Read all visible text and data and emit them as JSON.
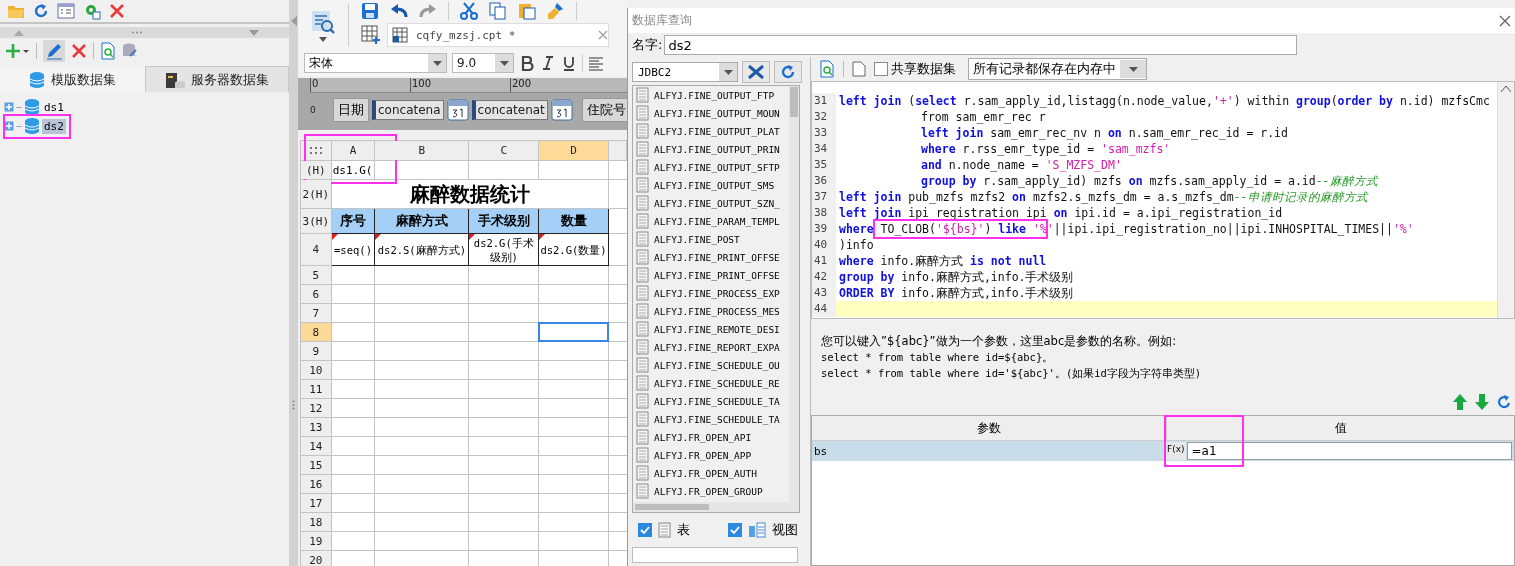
{
  "dataset_tabs": [
    {
      "label": "模版数据集",
      "selected": true
    },
    {
      "label": "服务器数据集",
      "selected": false
    }
  ],
  "datasets": [
    {
      "name": "ds1",
      "selected": false,
      "highlighted": false
    },
    {
      "name": "ds2",
      "selected": true,
      "highlighted": true
    }
  ],
  "designer": {
    "file_tab": "cqfy_mzsj.cpt *",
    "font": "宋体",
    "font_size": "9.0",
    "ruler_ticks": [
      "0",
      "100",
      "200"
    ],
    "ruler_side": "0",
    "params": [
      {
        "kind": "label",
        "text": "日期"
      },
      {
        "kind": "date",
        "text": "concatena"
      },
      {
        "kind": "date",
        "text": "concatenat"
      },
      {
        "kind": "label",
        "text": "住院号"
      }
    ],
    "sheet": {
      "corner_highlighted": true,
      "columns": [
        {
          "label": "A",
          "selected": false
        },
        {
          "label": "B",
          "selected": false
        },
        {
          "label": "C",
          "selected": false
        },
        {
          "label": "D",
          "selected": true
        }
      ],
      "rows": [
        {
          "header": "(H)",
          "kind": "plain",
          "selected": false,
          "cells": [
            "ds1.G("
          ]
        },
        {
          "header": "2(H)",
          "kind": "title",
          "selected": false,
          "cells": [
            "麻醉数据统计"
          ]
        },
        {
          "header": "3(H)",
          "kind": "heading",
          "selected": false,
          "cells": [
            "序号",
            "麻醉方式",
            "手术级别",
            "数量"
          ]
        },
        {
          "header": "4",
          "kind": "formula",
          "selected": false,
          "cells": [
            "=seq()",
            "ds2.S(麻醉方式)",
            "ds2.G(手术级别)",
            "ds2.G(数量)"
          ]
        },
        {
          "header": "5",
          "kind": "plain",
          "selected": false
        },
        {
          "header": "6",
          "kind": "plain",
          "selected": false
        },
        {
          "header": "7",
          "kind": "plain",
          "selected": false
        },
        {
          "header": "8",
          "kind": "plain",
          "selected": true
        },
        {
          "header": "9",
          "kind": "plain",
          "selected": false
        },
        {
          "header": "10",
          "kind": "plain",
          "selected": false
        },
        {
          "header": "11",
          "kind": "plain",
          "selected": false
        },
        {
          "header": "12",
          "kind": "plain",
          "selected": false
        },
        {
          "header": "13",
          "kind": "plain",
          "selected": false
        },
        {
          "header": "14",
          "kind": "plain",
          "selected": false
        },
        {
          "header": "15",
          "kind": "plain",
          "selected": false
        },
        {
          "header": "16",
          "kind": "plain",
          "selected": false
        },
        {
          "header": "17",
          "kind": "plain",
          "selected": false
        },
        {
          "header": "18",
          "kind": "plain",
          "selected": false
        },
        {
          "header": "19",
          "kind": "plain",
          "selected": false
        },
        {
          "header": "20",
          "kind": "plain",
          "selected": false
        }
      ]
    }
  },
  "dialog": {
    "title": "数据库查询",
    "name_label": "名字:",
    "name_value": "ds2",
    "connection": "JDBC2",
    "tables": [
      "ALFYJ.FINE_OUTPUT_FTP",
      "ALFYJ.FINE_OUTPUT_MOUN",
      "ALFYJ.FINE_OUTPUT_PLAT",
      "ALFYJ.FINE_OUTPUT_PRIN",
      "ALFYJ.FINE_OUTPUT_SFTP",
      "ALFYJ.FINE_OUTPUT_SMS",
      "ALFYJ.FINE_OUTPUT_SZN_",
      "ALFYJ.FINE_PARAM_TEMPL",
      "ALFYJ.FINE_POST",
      "ALFYJ.FINE_PRINT_OFFSE",
      "ALFYJ.FINE_PRINT_OFFSE",
      "ALFYJ.FINE_PROCESS_EXP",
      "ALFYJ.FINE_PROCESS_MES",
      "ALFYJ.FINE_REMOTE_DESI",
      "ALFYJ.FINE_REPORT_EXPA",
      "ALFYJ.FINE_SCHEDULE_OU",
      "ALFYJ.FINE_SCHEDULE_RE",
      "ALFYJ.FINE_SCHEDULE_TA",
      "ALFYJ.FINE_SCHEDULE_TA",
      "ALFYJ.FR_OPEN_API",
      "ALFYJ.FR_OPEN_APP",
      "ALFYJ.FR_OPEN_AUTH",
      "ALFYJ.FR_OPEN_GROUP"
    ],
    "table_types": [
      {
        "label": "表",
        "checked": true
      },
      {
        "label": "视图",
        "checked": true
      }
    ],
    "shared_dataset": {
      "label": "共享数据集",
      "checked": false
    },
    "storage_mode": "所有记录都保存在内存中",
    "sql_lines": [
      {
        "number": "31",
        "indent": false,
        "current": false,
        "highlighted": false,
        "segments": [
          {
            "kind": "kw",
            "text": "left join"
          },
          {
            "kind": "plain",
            "text": " ("
          },
          {
            "kind": "kw",
            "text": "select"
          },
          {
            "kind": "plain",
            "text": " r.sam_apply_id,listagg(n.node_value,"
          },
          {
            "kind": "str",
            "text": "'+'"
          },
          {
            "kind": "plain",
            "text": ") within "
          },
          {
            "kind": "kw",
            "text": "group"
          },
          {
            "kind": "plain",
            "text": "("
          },
          {
            "kind": "kw",
            "text": "order by"
          },
          {
            "kind": "plain",
            "text": " n.id) mzfsCmc"
          }
        ]
      },
      {
        "number": "32",
        "indent": true,
        "current": false,
        "highlighted": false,
        "segments": [
          {
            "kind": "plain",
            "text": "from sam_emr_rec r"
          }
        ]
      },
      {
        "number": "33",
        "indent": true,
        "current": false,
        "highlighted": false,
        "segments": [
          {
            "kind": "kw",
            "text": "left join"
          },
          {
            "kind": "plain",
            "text": " sam_emr_rec_nv n "
          },
          {
            "kind": "kw",
            "text": "on"
          },
          {
            "kind": "plain",
            "text": " n.sam_emr_rec_id = r.id"
          }
        ]
      },
      {
        "number": "34",
        "indent": true,
        "current": false,
        "highlighted": false,
        "segments": [
          {
            "kind": "kw",
            "text": "where"
          },
          {
            "kind": "plain",
            "text": " r.rss_emr_type_id = "
          },
          {
            "kind": "str",
            "text": "'sam_mzfs'"
          }
        ]
      },
      {
        "number": "35",
        "indent": true,
        "current": false,
        "highlighted": false,
        "segments": [
          {
            "kind": "kw",
            "text": "and"
          },
          {
            "kind": "plain",
            "text": " n.node_name = "
          },
          {
            "kind": "str",
            "text": "'S_MZFS_DM'"
          }
        ]
      },
      {
        "number": "36",
        "indent": true,
        "current": false,
        "highlighted": false,
        "segments": [
          {
            "kind": "kw",
            "text": "group by"
          },
          {
            "kind": "plain",
            "text": " r.sam_apply_id) mzfs "
          },
          {
            "kind": "kw",
            "text": "on"
          },
          {
            "kind": "plain",
            "text": " mzfs.sam_apply_id = a.id"
          },
          {
            "kind": "comment",
            "text": "--麻醉方式"
          }
        ]
      },
      {
        "number": "37",
        "indent": false,
        "current": false,
        "highlighted": false,
        "segments": [
          {
            "kind": "kw",
            "text": "left join"
          },
          {
            "kind": "plain",
            "text": " pub_mzfs mzfs2 "
          },
          {
            "kind": "kw",
            "text": "on"
          },
          {
            "kind": "plain",
            "text": " mzfs2.s_mzfs_dm = a.s_mzfs_dm"
          },
          {
            "kind": "comment",
            "text": "--申请时记录的麻醉方式"
          }
        ]
      },
      {
        "number": "38",
        "indent": false,
        "current": false,
        "highlighted": false,
        "segments": [
          {
            "kind": "kw",
            "text": "left join"
          },
          {
            "kind": "plain",
            "text": " ipi_registration ipi "
          },
          {
            "kind": "kw",
            "text": "on"
          },
          {
            "kind": "plain",
            "text": " ipi.id = a.ipi_registration_id"
          }
        ]
      },
      {
        "number": "39",
        "indent": false,
        "current": false,
        "highlighted": true,
        "segments": [
          {
            "kind": "kw",
            "text": "where"
          },
          {
            "kind": "plain",
            "text": " TO_CLOB("
          },
          {
            "kind": "str",
            "text": "'${bs}'"
          },
          {
            "kind": "plain",
            "text": ") "
          },
          {
            "kind": "kw",
            "text": "like"
          },
          {
            "kind": "str",
            "text": " '%'"
          },
          {
            "kind": "plain",
            "text": "||ipi.ipi_registration_no||ipi.INHOSPITAL_TIMES||"
          },
          {
            "kind": "str",
            "text": "'%'"
          }
        ]
      },
      {
        "number": "40",
        "indent": false,
        "current": false,
        "highlighted": false,
        "segments": [
          {
            "kind": "plain",
            "text": ")info"
          }
        ]
      },
      {
        "number": "41",
        "indent": false,
        "current": false,
        "highlighted": false,
        "segments": [
          {
            "kind": "kw",
            "text": "where"
          },
          {
            "kind": "plain",
            "text": " info.麻醉方式 "
          },
          {
            "kind": "kw",
            "text": "is not null"
          }
        ]
      },
      {
        "number": "42",
        "indent": false,
        "current": false,
        "highlighted": false,
        "segments": [
          {
            "kind": "kw",
            "text": "group by"
          },
          {
            "kind": "plain",
            "text": " info.麻醉方式,info.手术级别"
          }
        ]
      },
      {
        "number": "43",
        "indent": false,
        "current": false,
        "highlighted": false,
        "segments": [
          {
            "kind": "kw",
            "text": "ORDER BY"
          },
          {
            "kind": "plain",
            "text": " info.麻醉方式,info.手术级别"
          }
        ]
      },
      {
        "number": "44",
        "current": true,
        "highlighted": false
      }
    ],
    "hint_lines": [
      "您可以键入”${abc}”做为一个参数，这里abc是参数的名称。例如:",
      "select * from table where id=${abc}。",
      "select * from table where id='${abc}'。(如果id字段为字符串类型)"
    ],
    "param_columns": [
      "参数",
      "值"
    ],
    "formula_button": "F(x)",
    "param_rows": [
      {
        "name": "bs",
        "value": "=a1",
        "selected": true,
        "highlighted": true
      }
    ]
  }
}
